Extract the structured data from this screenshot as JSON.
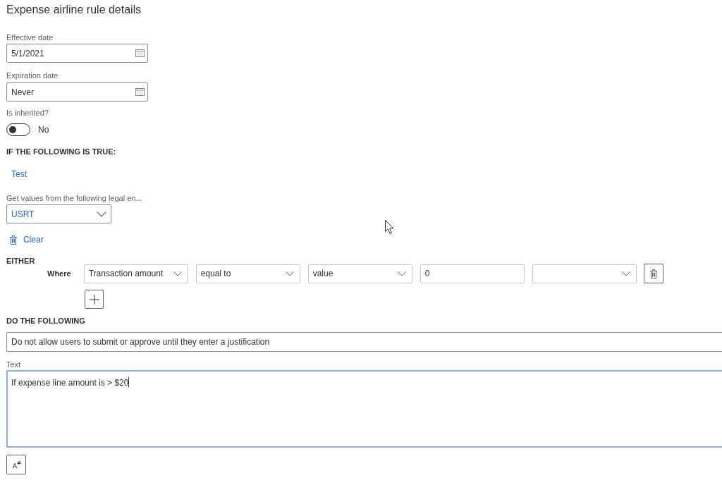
{
  "page": {
    "title": "Expense airline rule details"
  },
  "dates": [
    {
      "label": "Effective date",
      "value": "5/1/2021"
    },
    {
      "label": "Expiration date",
      "value": "Never"
    }
  ],
  "is_inherited": {
    "label": "Is inherited?",
    "on": false,
    "state_text": "No"
  },
  "condition_section": {
    "heading": "IF THE FOLLOWING IS TRUE:",
    "test_link": "Test",
    "legal_entity": {
      "label": "Get values from the following legal en...",
      "value": "USRT"
    },
    "clear_link": "Clear"
  },
  "either": {
    "heading": "EITHER",
    "where_label": "Where",
    "conditions": [
      {
        "kind": "dropdown",
        "value": "Transaction amount"
      },
      {
        "kind": "dropdown",
        "value": "equal to"
      },
      {
        "kind": "dropdown",
        "value": "value"
      },
      {
        "kind": "input",
        "value": "0"
      },
      {
        "kind": "dropdown"
      }
    ]
  },
  "action": {
    "heading": "DO THE FOLLOWING",
    "value": "Do not allow users to submit or approve until they enter a justification"
  },
  "text_field": {
    "label": "Text",
    "value": "If expense line amount is > $20",
    "focused": true
  }
}
